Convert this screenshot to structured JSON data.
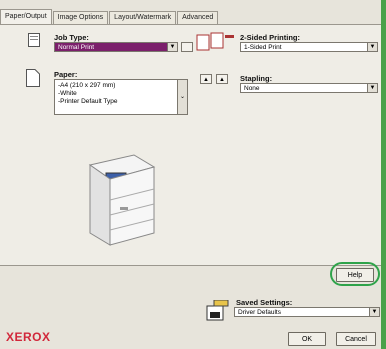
{
  "tabs": [
    "Paper/Output",
    "Image Options",
    "Layout/Watermark",
    "Advanced"
  ],
  "job_type": {
    "label": "Job Type:",
    "value": "Normal Print"
  },
  "two_sided": {
    "label": "2-Sided Printing:",
    "value": "1-Sided Print"
  },
  "paper": {
    "label": "Paper:",
    "lines": [
      "-A4 (210 x 297 mm)",
      "-White",
      "-Printer Default Type"
    ]
  },
  "stapling": {
    "label": "Stapling:",
    "value": "None"
  },
  "help_label": "Help",
  "saved_settings": {
    "label": "Saved Settings:",
    "value": "Driver Defaults"
  },
  "ok_label": "OK",
  "cancel_label": "Cancel",
  "brand": "XEROX",
  "colors": {
    "accent_highlight": "#7b1f6b",
    "help_circle": "#2fa34a",
    "brand_red": "#d1273a"
  },
  "icons": [
    "job-type-icon",
    "folder-icon",
    "paper-icon",
    "printer-illustration",
    "saved-settings-icon",
    "dropdown-arrow-icon"
  ]
}
